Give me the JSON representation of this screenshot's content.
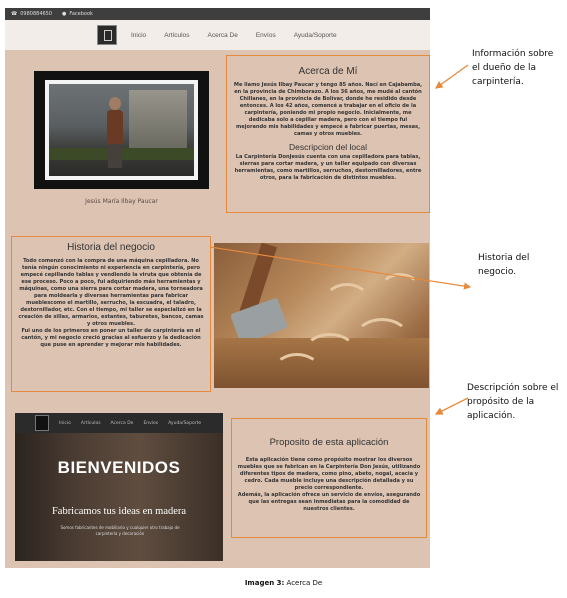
{
  "topbar": {
    "phone": "0980884650",
    "social": "Facebook"
  },
  "nav": {
    "items": [
      "Inicio",
      "Artículos",
      "Acerca De",
      "Envíos",
      "Ayuda/Soporte"
    ]
  },
  "owner_photo_caption": "Jesús María Ilbay Paucar",
  "acerca": {
    "title": "Acerca de Mí",
    "text": "Me llamo Jesús Ilbay Paucar y tengo 85 años. Nací en Cajabamba, en la provincia de Chimborazo. A los 36 años, me mudé al cantón Chillanes, en la provincia de Bolívar, donde he residido desde entonces. A los 42 años, comencé a trabajar en el oficio de la carpintería, poniendo mi propio negocio. Inicialmente, me dedicaba solo a cepillar madera, pero con el tiempo fui mejorando mis habilidades y empecé a fabricar puertas, mesas, camas y otros muebles.",
    "local_title": "Descripcion del local",
    "local_text": "La Carpintería DonJesús cuenta con una cepilladora para tablas, sierras para cortar madera, y un taller equipado con diversas herramientas, como martillos, serruchos, destornilladores, entre otros, para la fabricación de distintos muebles."
  },
  "historia": {
    "title": "Historia del negocio",
    "text": "Todo comenzó con la compra de una máquina cepilladora. No tenía ningún conocimiento ni experiencia en carpintería, pero empecé cepillando tablas y vendiendo la viruta que obtenía de ese proceso. Poco a poco, fui adquiriendo más herramientas y máquinas, como una sierra para cortar madera, una torneadora para moldearla y diversas herramientas para fabricar mueblescomo el martillo, serrucho, la escuadra, el taladro, destornillador, etc. Con el tiempo, mi taller se especializó en la creación de sillas, armarios, estantes, taburetes, bancos, camas y otros muebles.",
    "text2": "Fui uno de los primeros en poner un taller de carpintería en el cantón, y mi negocio creció gracias al esfuerzo y la dedicación que puse en aprender y mejorar mis habilidades."
  },
  "proposito": {
    "title": "Proposito de esta aplicación",
    "text": "Esta aplicación tiene como propósito mostrar los diversos muebles que se fabrican en la Carpintería Don Jesús, utilizando diferentes tipos de madera, como pino, abeto, nogal, acacia y cedro. Cada mueble incluye una descripción detallada y su precio correspondiente.",
    "text2": "Además, la aplicación ofrece un servicio de envíos, asegurando que las entregas sean inmediatas para la comodidad de nuestros clientes."
  },
  "hero": {
    "nav": [
      "Inicio",
      "Artículos",
      "Acerca De",
      "Envíos",
      "Ayuda/Soporte"
    ],
    "title": "BIENVENIDOS",
    "subtitle": "Fabricamos tus ideas en madera",
    "text": "Somos fabricantes de mobiliario y cualquier otro trabajo de carpintería y decoración"
  },
  "annotations": {
    "a1": "Información sobre el dueño de la carpintería.",
    "a2": "Historia del negocio.",
    "a3": "Descripción sobre el propósito de la aplicación."
  },
  "figure_caption": {
    "label": "Imagen 3:",
    "title": "Acerca De"
  },
  "colors": {
    "page_bg": "#dcc3b2",
    "border_orange": "#e58a3c",
    "topbar": "#3e3e3e",
    "navbar": "#f3ede9"
  }
}
